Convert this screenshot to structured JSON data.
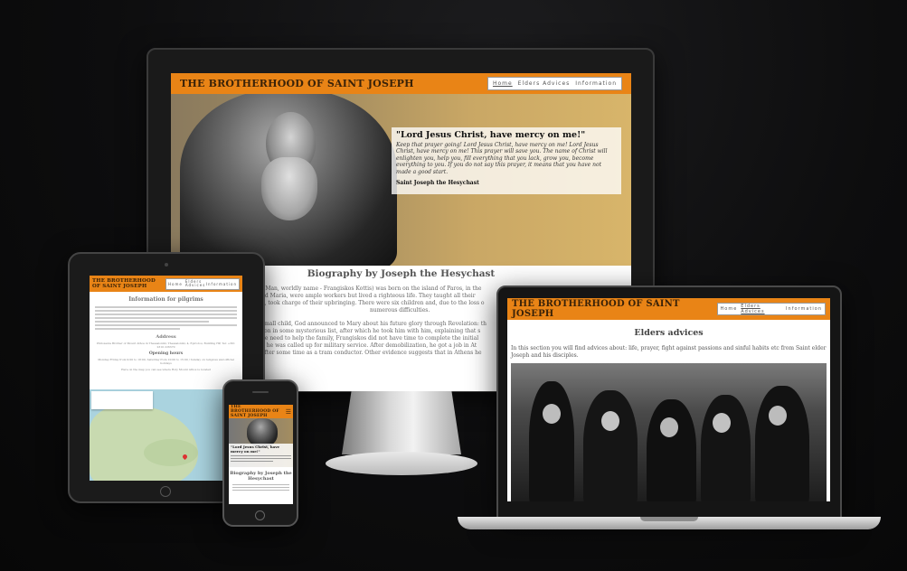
{
  "site": {
    "title": "THE BROTHERHOOD OF SAINT JOSEPH"
  },
  "nav": {
    "home": "Home",
    "elders": "Elders Advices",
    "info": "Information"
  },
  "hero": {
    "quote_title": "\"Lord Jesus Christ, have mercy on me!\"",
    "quote_text": "Keep that prayer going! Lord Jesus Christ, have mercy on me! Lord Jesus Christ, have mercy on me! This prayer will save you. The name of Christ will enlighten you, help you, fill everything that you lack, grow you, become everything to you. If you do not say this prayer, it means that you have not made a good start.",
    "quote_author": "Saint Joseph the Hesychast"
  },
  "biography": {
    "heading": "Biography by Joseph the Hesychast",
    "line1": "t Man, worldly name - Frangiskos Kottis) was born on the island of Paros, in the",
    "line2": "nd Maria, were ample workers but lived a righteous life. They taught all their",
    "line3": "a, took charge of their upbringing. There were six children and, due to the loss o",
    "line4": "numerous difficulties.",
    "line5": "small child, God announced to Mary about his future glory through Revelation: th",
    "line6": "son in some mysterious list, after which he took him with him, explaining that s",
    "line7": "he need to help the family, Frangiskos did not have time to complete the initial",
    "line8": "n he was called up for military service. After demobilization, he got a job in At",
    "line9": "after some time as a tram conductor. Other evidence suggests that in Athens he"
  },
  "laptop": {
    "heading": "Elders advices",
    "text": "In this section you will find advices about: life, prayer, fight against passions and sinful habits etc from Saint elder Joseph and his disciples."
  },
  "tablet": {
    "brand": "THE BROTHERHOOD OF SAINT JOSEPH",
    "nav_home": "Home",
    "nav_elders": "Elders Advices",
    "nav_info": "Information",
    "info_heading": "Information for pilgrims",
    "address_heading": "Address",
    "address_text": "Philoxenia Brother of Mount Athos in Thessaloniki, Thessaloniki, 4, Epirotou, Building HP, Tel: +301 2310 226370",
    "hours_heading": "Opening hours",
    "hours_text": "Monday-Friday from 9:00 to 18:00, Saturday from 10:00 to 15:00 / Sunday on religious and official holidays",
    "map_note": "Here on the map you can see where Holy Mount Athos is located"
  },
  "phone": {
    "brand": "THE BROTHERHOOD OF SAINT JOSEPH",
    "quote_title": "\"Lord Jesus Christ, have mercy on me!\"",
    "bio_heading": "Biography by Joseph the Hesychast"
  }
}
